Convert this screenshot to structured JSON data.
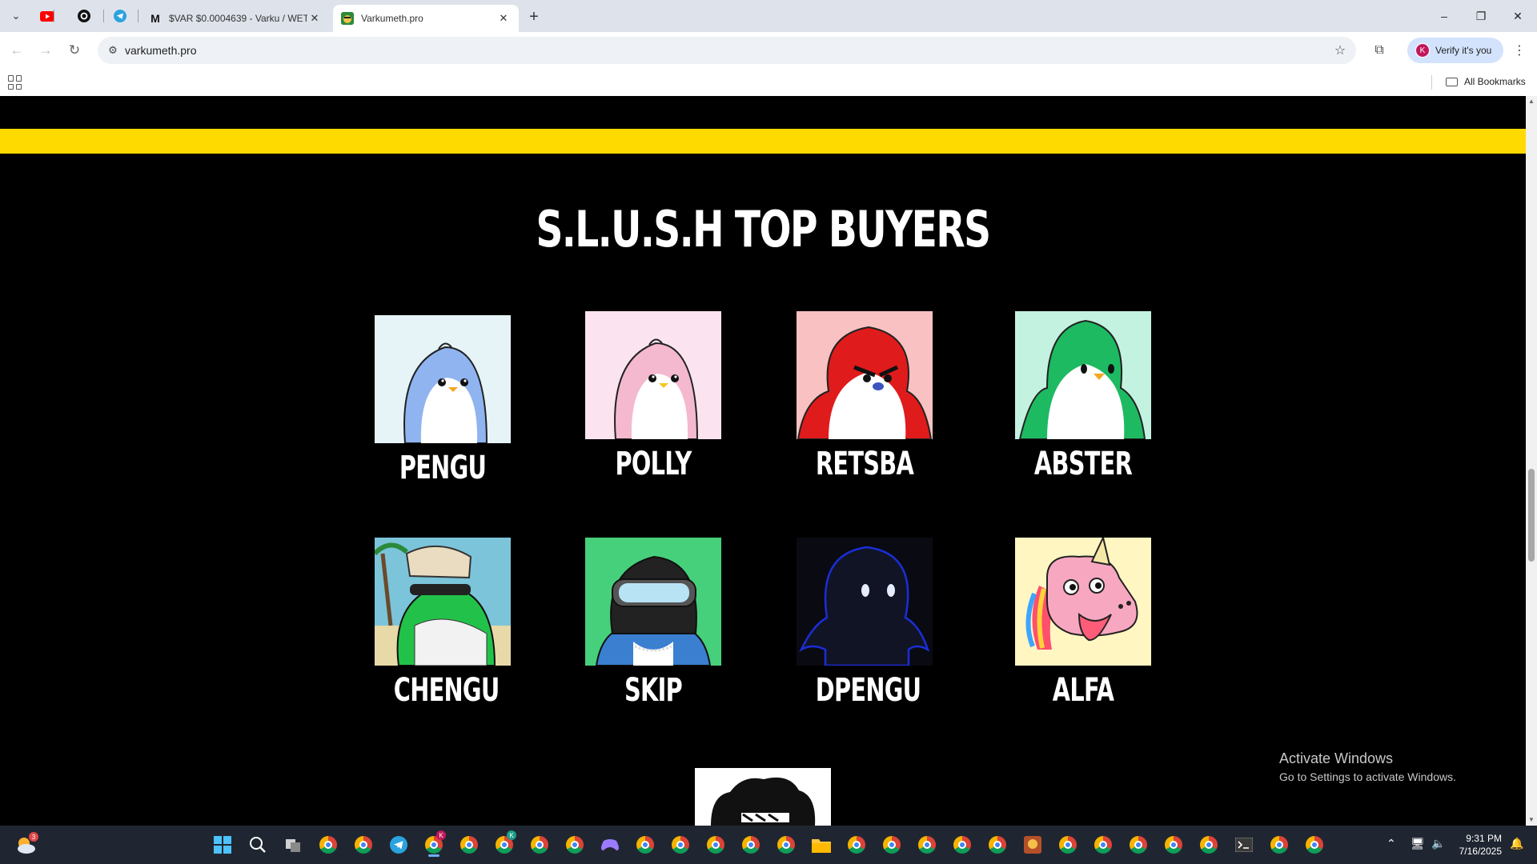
{
  "browser": {
    "tabs": [
      {
        "title": "$VAR $0.0004639 - Varku / WET",
        "close": "✕"
      },
      {
        "title": "Varkumeth.pro",
        "close": "✕"
      }
    ],
    "new_tab": "+",
    "url": "varkumeth.pro",
    "verify_label": "Verify it's you",
    "avatar_letter": "K",
    "all_bookmarks": "All Bookmarks",
    "window_controls": {
      "minimize": "–",
      "restore": "❐",
      "close": "✕"
    }
  },
  "page": {
    "heading": "S.L.U.S.H TOP BUYERS",
    "band_color": "#ffda00",
    "buyers": [
      {
        "name": "PENGU",
        "bg": "#e6f4f8",
        "body": "#8fb4f0",
        "style": "cute"
      },
      {
        "name": "POLLY",
        "bg": "#fbe4ef",
        "body": "#f4b9cf",
        "style": "cute"
      },
      {
        "name": "RETSBA",
        "bg": "#f9c1c1",
        "body": "#e01b1b",
        "style": "angry"
      },
      {
        "name": "ABSTER",
        "bg": "#c4f2e0",
        "body": "#1dba62",
        "style": "plain"
      },
      {
        "name": "CHENGU",
        "bg": "#7cc4d9",
        "body": "#22c24a",
        "style": "muscle"
      },
      {
        "name": "SKIP",
        "bg": "#47d07b",
        "body": "#222222",
        "style": "goggles"
      },
      {
        "name": "DPENGU",
        "bg": "#0a0a12",
        "body": "#111425",
        "style": "dark"
      },
      {
        "name": "ALFA",
        "bg": "#fff6c2",
        "body": "#f7a8c0",
        "style": "unicorn"
      }
    ]
  },
  "overlay": {
    "activate_title": "Activate Windows",
    "activate_sub": "Go to Settings to activate Windows."
  },
  "taskbar": {
    "time": "9:31 PM",
    "date": "7/16/2025",
    "weather_badge": "3"
  }
}
